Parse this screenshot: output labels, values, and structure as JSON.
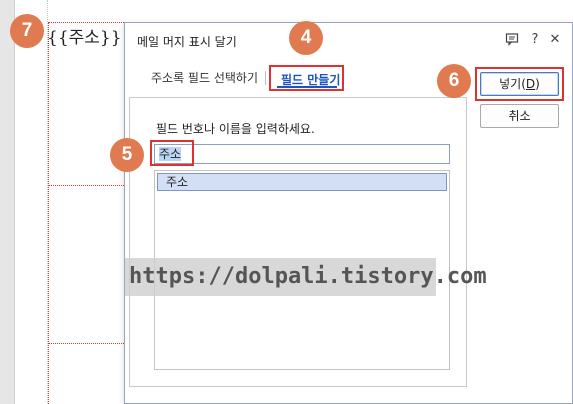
{
  "document": {
    "field_placeholder": "{{주소}}"
  },
  "dialog": {
    "title": "메일 머지 표시 달기",
    "titlebar_buttons": {
      "help_glyph": "?",
      "close_glyph": "✕"
    },
    "tabs": [
      {
        "label": "주소록 필드 선택하기",
        "active": false
      },
      {
        "label": "필드 만들기",
        "active": true
      }
    ],
    "panel": {
      "prompt": "필드 번호나 이름을 입력하세요.",
      "input_value": "주소",
      "list_items": [
        "주소"
      ]
    },
    "buttons": {
      "insert_label": "넣기(",
      "insert_mnemonic": "D",
      "insert_label_end": ")",
      "cancel_label": "취소"
    }
  },
  "annotations": {
    "badge_1": "7",
    "badge_2": "4",
    "badge_3": "6",
    "badge_4": "5"
  },
  "watermark": "https://dolpali.tistory.com",
  "colors": {
    "badge": "#e07a50",
    "highlight_box": "#e0302f",
    "active_tab_text": "#1a56c0"
  }
}
